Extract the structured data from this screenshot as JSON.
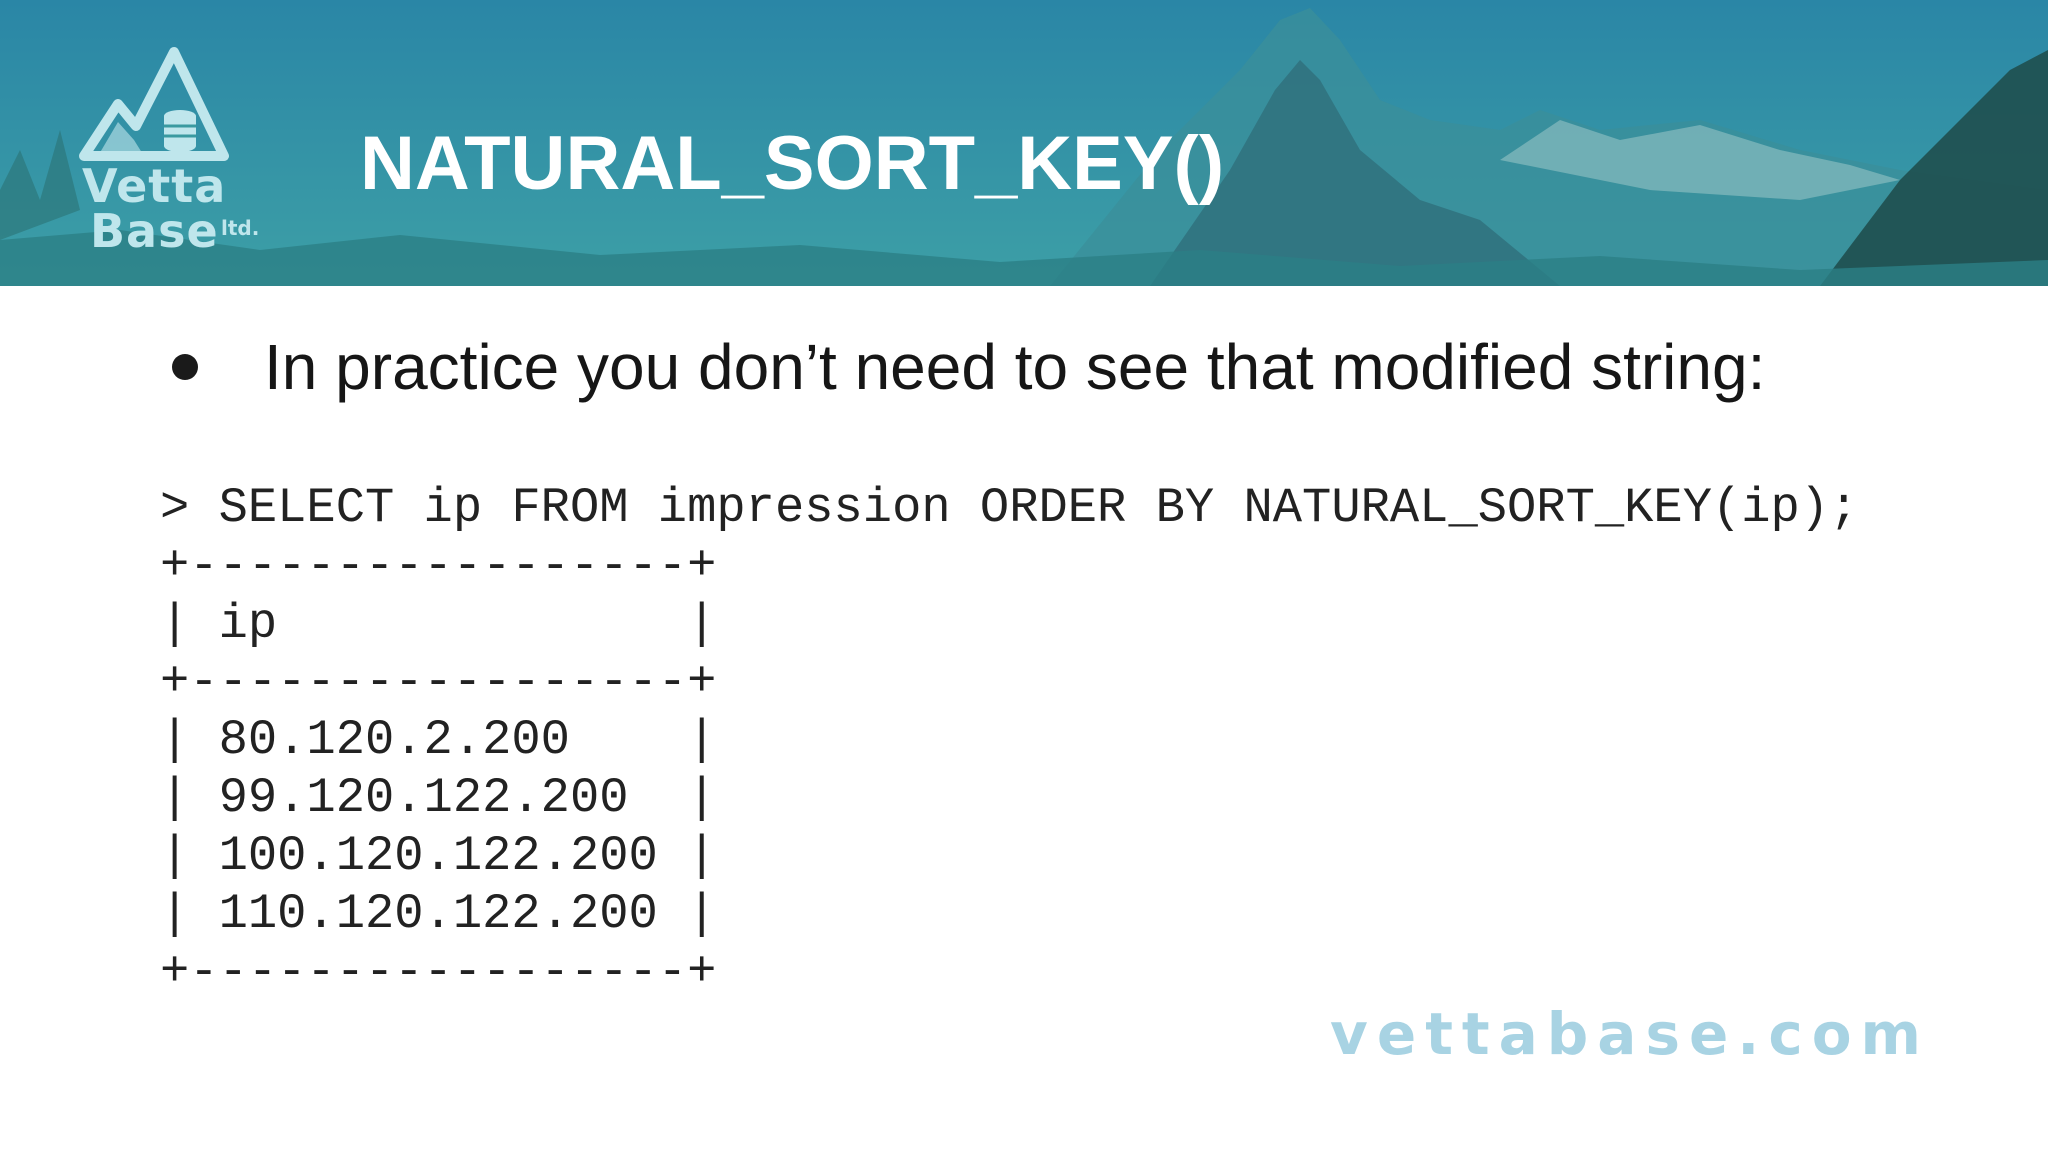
{
  "header": {
    "title": "NATURAL_SORT_KEY()",
    "logo": {
      "line1": "Vetta",
      "line2": "Base",
      "suffix": "ltd."
    },
    "colors": {
      "banner_top": "#2b88a6",
      "banner_bottom": "#3a9aa0",
      "logo": "#bfe6ec"
    }
  },
  "content": {
    "bullet": "In practice you don’t need to see that modified string:",
    "code_lines": [
      "> SELECT ip FROM impression ORDER BY NATURAL_SORT_KEY(ip);",
      "+-----------------+",
      "| ip              |",
      "+-----------------+",
      "| 80.120.2.200    |",
      "| 99.120.122.200  |",
      "| 100.120.122.200 |",
      "| 110.120.122.200 |",
      "+-----------------+"
    ]
  },
  "footer": {
    "url": "vettabase.com",
    "color": "#a8d3e3"
  }
}
